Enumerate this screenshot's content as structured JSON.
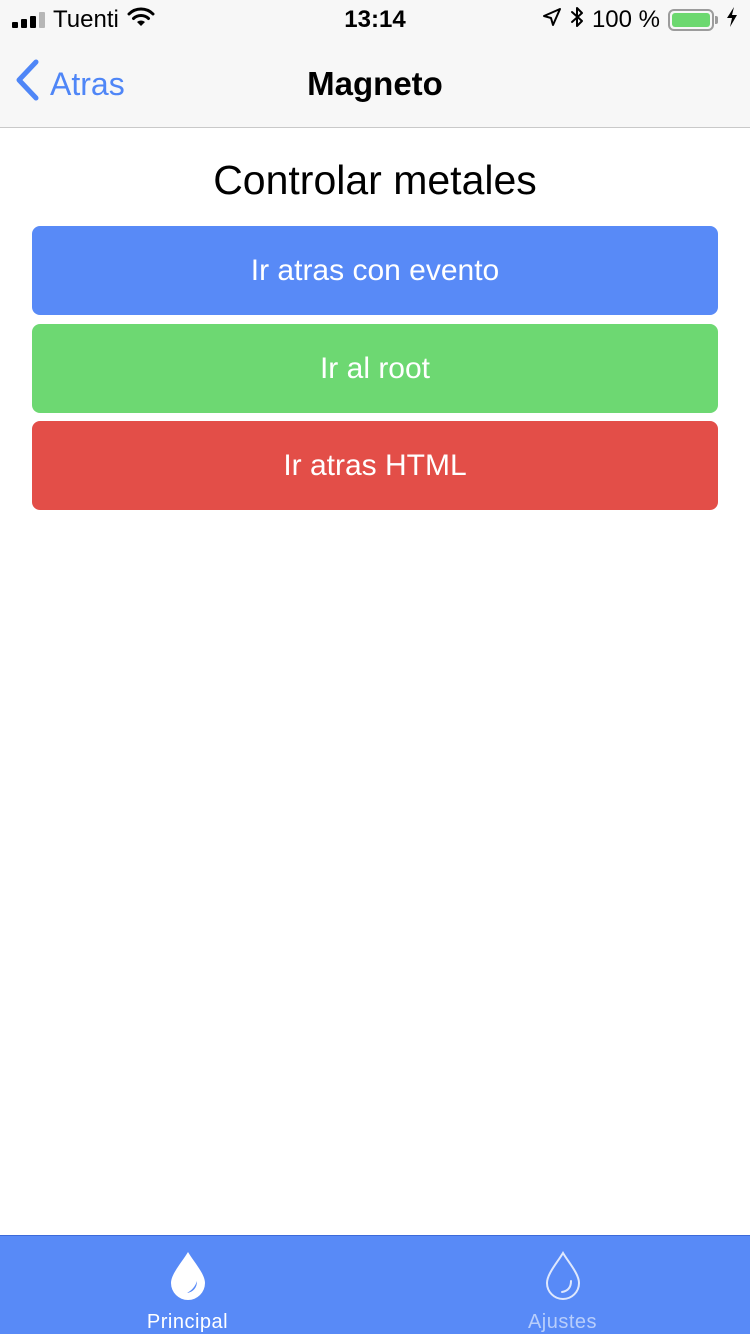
{
  "status_bar": {
    "carrier": "Tuenti",
    "time": "13:14",
    "battery_text": "100 %",
    "battery_level": 1.0,
    "icons": [
      "signal-icon",
      "wifi-icon",
      "location-arrow-icon",
      "bluetooth-icon",
      "battery-icon",
      "charging-bolt-icon"
    ]
  },
  "nav": {
    "back_label": "Atras",
    "title": "Magneto",
    "back_icon": "chevron-left-icon"
  },
  "main": {
    "title": "Controlar metales",
    "buttons": [
      {
        "label": "Ir atras con evento",
        "color": "#588af7"
      },
      {
        "label": "Ir al root",
        "color": "#6dd872"
      },
      {
        "label": "Ir atras HTML",
        "color": "#e34e48"
      }
    ]
  },
  "tab_bar": {
    "background": "#588af7",
    "tabs": [
      {
        "label": "Principal",
        "icon": "water-drop-filled-icon",
        "selected": true
      },
      {
        "label": "Ajustes",
        "icon": "water-drop-outline-icon",
        "selected": false
      }
    ]
  },
  "colors": {
    "accent": "#4f86f7",
    "bar_background": "#f7f7f7",
    "battery_green": "#6cd86f",
    "tab_selected": "#ffffff",
    "tab_unselected": "#b8cefb"
  }
}
